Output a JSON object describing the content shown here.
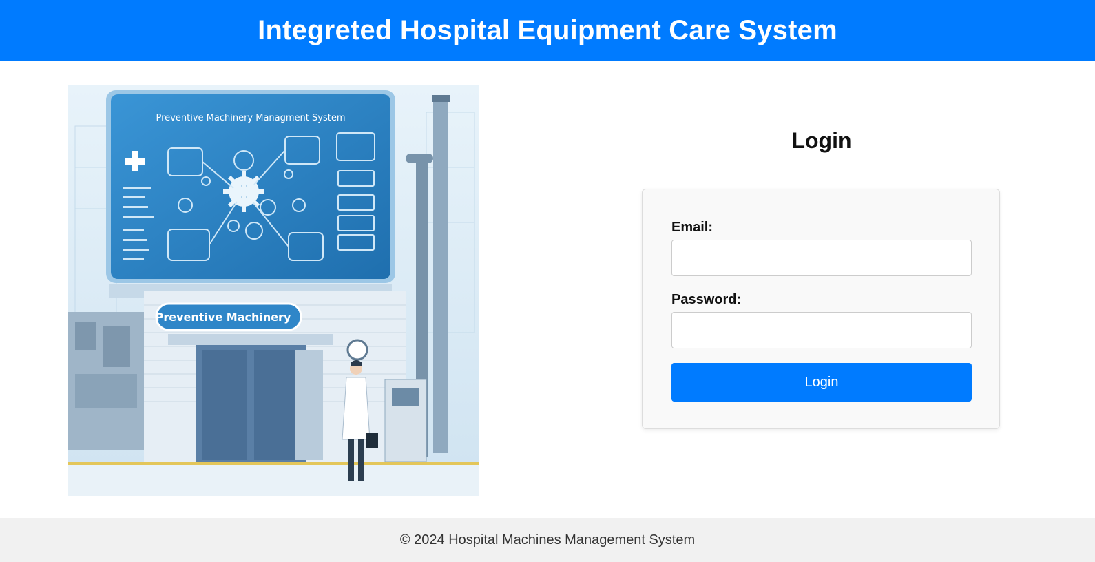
{
  "header": {
    "title": "Integreted Hospital Equipment Care System"
  },
  "illustration": {
    "board_title": "Preventive Machinery Managment System",
    "sign_text": "Preventive Machinery",
    "colors": {
      "sky": "#dcecf7",
      "board": "#2f86c8",
      "building": "#e6eef5",
      "accent": "#4a7fb0"
    }
  },
  "login": {
    "title": "Login",
    "email_label": "Email:",
    "email_value": "",
    "password_label": "Password:",
    "password_value": "",
    "button_label": "Login"
  },
  "footer": {
    "text": "© 2024 Hospital Machines Management System"
  },
  "colors": {
    "primary": "#007bff",
    "footer_bg": "#f1f1f1",
    "card_bg": "#f9f9f9"
  }
}
